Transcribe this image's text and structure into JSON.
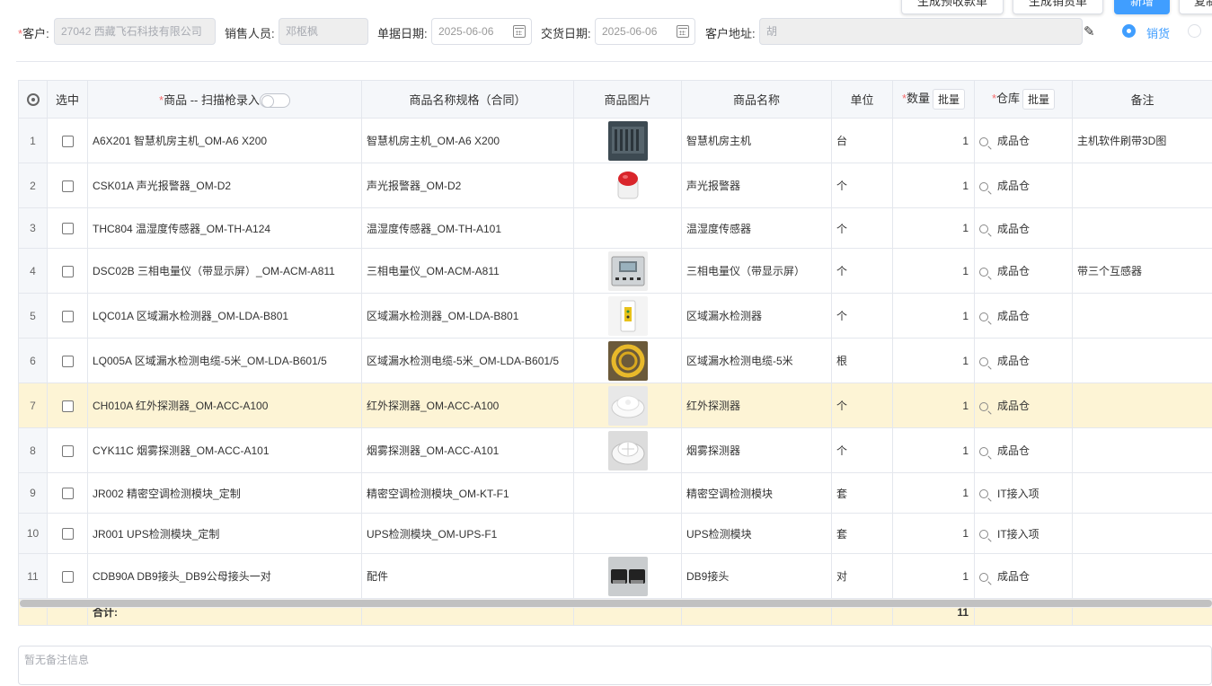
{
  "toolbar": {
    "btn_receipt": "生成预收款单",
    "btn_delivery": "生成销货单",
    "btn_add": "新增",
    "btn_more": "复制"
  },
  "header": {
    "customer_label": "客户:",
    "customer_value": "27042 西藏飞石科技有限公司",
    "salesperson_label": "销售人员:",
    "salesperson_value": "邓枢枫",
    "doc_date_label": "单据日期:",
    "doc_date_value": "2025-06-06",
    "delivery_date_label": "交货日期:",
    "delivery_date_value": "2025-06-06",
    "address_label": "客户地址:",
    "address_value": "胡",
    "radio_sales": "销货"
  },
  "table": {
    "headers": {
      "select": "选中",
      "product": "商品 -- 扫描枪录入",
      "spec": "商品名称规格（合同）",
      "image": "商品图片",
      "name": "商品名称",
      "unit": "单位",
      "qty": "数量",
      "qty_batch": "批量",
      "warehouse": "仓库",
      "wh_batch": "批量",
      "remark": "备注"
    },
    "rows": [
      {
        "idx": "1",
        "product": "A6X201 智慧机房主机_OM-A6 X200",
        "spec": "智慧机房主机_OM-A6 X200",
        "name": "智慧机房主机",
        "unit": "台",
        "qty": "1",
        "warehouse": "成品仓",
        "remark": "主机软件刷带3D图"
      },
      {
        "idx": "2",
        "product": "CSK01A 声光报警器_OM-D2",
        "spec": "声光报警器_OM-D2",
        "name": "声光报警器",
        "unit": "个",
        "qty": "1",
        "warehouse": "成品仓",
        "remark": ""
      },
      {
        "idx": "3",
        "product": "THC804 温湿度传感器_OM-TH-A124",
        "spec": "温湿度传感器_OM-TH-A101",
        "name": "温湿度传感器",
        "unit": "个",
        "qty": "1",
        "warehouse": "成品仓",
        "remark": ""
      },
      {
        "idx": "4",
        "product": "DSC02B 三相电量仪（带显示屏）_OM-ACM-A811",
        "spec": "三相电量仪_OM-ACM-A811",
        "name": "三相电量仪（带显示屏）",
        "unit": "个",
        "qty": "1",
        "warehouse": "成品仓",
        "remark": "带三个互感器"
      },
      {
        "idx": "5",
        "product": "LQC01A 区域漏水检测器_OM-LDA-B801",
        "spec": "区域漏水检测器_OM-LDA-B801",
        "name": "区域漏水检测器",
        "unit": "个",
        "qty": "1",
        "warehouse": "成品仓",
        "remark": ""
      },
      {
        "idx": "6",
        "product": "LQ005A 区域漏水检测电缆-5米_OM-LDA-B601/5",
        "spec": "区域漏水检测电缆-5米_OM-LDA-B601/5",
        "name": "区域漏水检测电缆-5米",
        "unit": "根",
        "qty": "1",
        "warehouse": "成品仓",
        "remark": ""
      },
      {
        "idx": "7",
        "product": "CH010A 红外探测器_OM-ACC-A100",
        "spec": "红外探测器_OM-ACC-A100",
        "name": "红外探测器",
        "unit": "个",
        "qty": "1",
        "warehouse": "成品仓",
        "remark": ""
      },
      {
        "idx": "8",
        "product": "CYK11C 烟雾探测器_OM-ACC-A101",
        "spec": "烟雾探测器_OM-ACC-A101",
        "name": "烟雾探测器",
        "unit": "个",
        "qty": "1",
        "warehouse": "成品仓",
        "remark": ""
      },
      {
        "idx": "9",
        "product": "JR002 精密空调检测模块_定制",
        "spec": "精密空调检测模块_OM-KT-F1",
        "name": "精密空调检测模块",
        "unit": "套",
        "qty": "1",
        "warehouse": "IT接入项",
        "remark": ""
      },
      {
        "idx": "10",
        "product": "JR001 UPS检测模块_定制",
        "spec": "UPS检测模块_OM-UPS-F1",
        "name": "UPS检测模块",
        "unit": "套",
        "qty": "1",
        "warehouse": "IT接入项",
        "remark": ""
      },
      {
        "idx": "11",
        "product": "CDB90A DB9接头_DB9公母接头一对",
        "spec": "配件",
        "name": "DB9接头",
        "unit": "对",
        "qty": "1",
        "warehouse": "成品仓",
        "remark": ""
      }
    ],
    "footer": {
      "label": "合计:",
      "total_qty": "11"
    }
  },
  "remark_placeholder": "暂无备注信息",
  "colors": {
    "primary": "#409eff",
    "highlight_row": "#fdf4d5",
    "required": "#f56c6c"
  }
}
